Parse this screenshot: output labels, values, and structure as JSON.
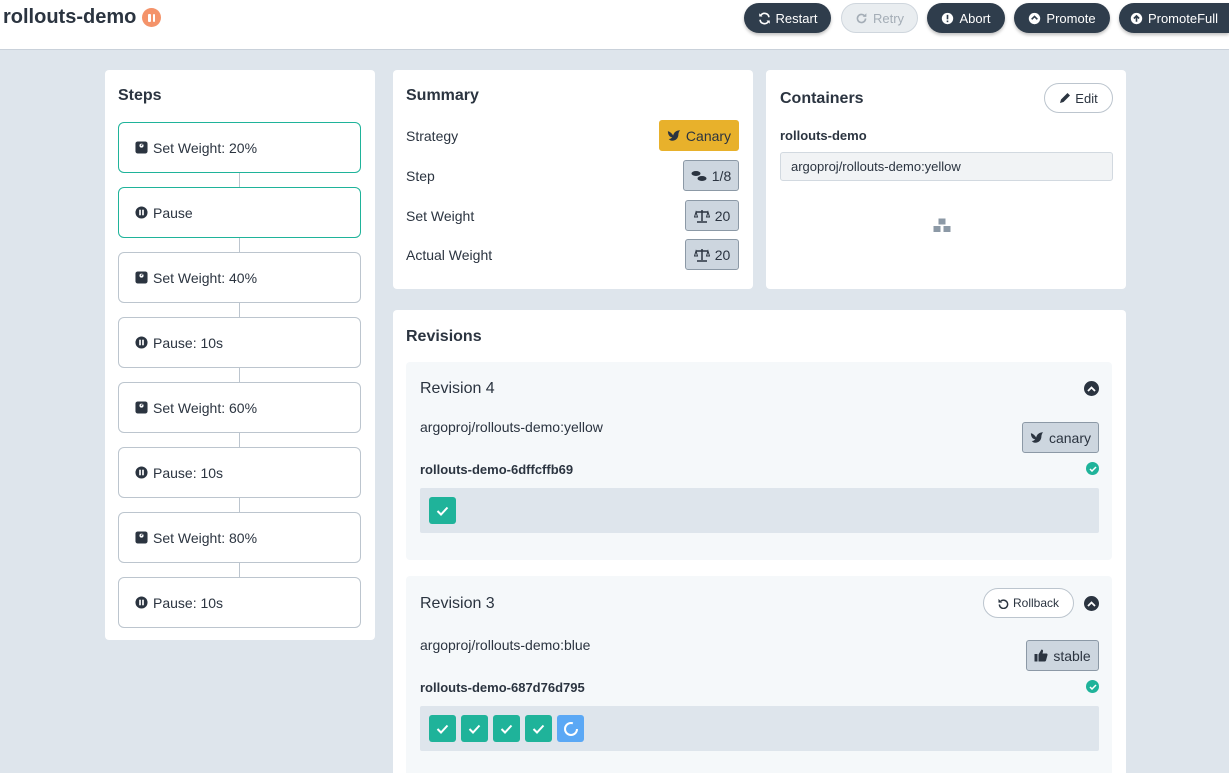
{
  "header": {
    "title": "rollouts-demo",
    "status_icon": "paused-icon",
    "buttons": {
      "restart": "Restart",
      "retry": "Retry",
      "abort": "Abort",
      "promote": "Promote",
      "promote_full": "PromoteFull"
    }
  },
  "steps": {
    "title": "Steps",
    "items": [
      {
        "label": "Set Weight: 20%",
        "icon": "weight-icon",
        "active": true
      },
      {
        "label": "Pause",
        "icon": "pause-icon",
        "active": true
      },
      {
        "label": "Set Weight: 40%",
        "icon": "weight-icon",
        "active": false
      },
      {
        "label": "Pause: 10s",
        "icon": "pause-icon",
        "active": false
      },
      {
        "label": "Set Weight: 60%",
        "icon": "weight-icon",
        "active": false
      },
      {
        "label": "Pause: 10s",
        "icon": "pause-icon",
        "active": false
      },
      {
        "label": "Set Weight: 80%",
        "icon": "weight-icon",
        "active": false
      },
      {
        "label": "Pause: 10s",
        "icon": "pause-icon",
        "active": false
      }
    ]
  },
  "summary": {
    "title": "Summary",
    "strategy_label": "Strategy",
    "strategy_value": "Canary",
    "step_label": "Step",
    "step_value": "1/8",
    "set_weight_label": "Set Weight",
    "set_weight_value": "20",
    "actual_weight_label": "Actual Weight",
    "actual_weight_value": "20"
  },
  "containers": {
    "title": "Containers",
    "edit_label": "Edit",
    "name": "rollouts-demo",
    "image": "argoproj/rollouts-demo:yellow"
  },
  "revisions": {
    "title": "Revisions",
    "items": [
      {
        "title": "Revision 4",
        "image": "argoproj/rollouts-demo:yellow",
        "badge": "canary",
        "replicaset": "rollouts-demo-6dffcffb69"
      },
      {
        "title": "Revision 3",
        "image": "argoproj/rollouts-demo:blue",
        "badge": "stable",
        "rollback_label": "Rollback",
        "replicaset": "rollouts-demo-687d76d795"
      }
    ]
  },
  "colors": {
    "accent": "#1fb39a",
    "canary": "#e8b12b",
    "paused": "#f4936a",
    "dark_button": "#2f3d4c"
  }
}
